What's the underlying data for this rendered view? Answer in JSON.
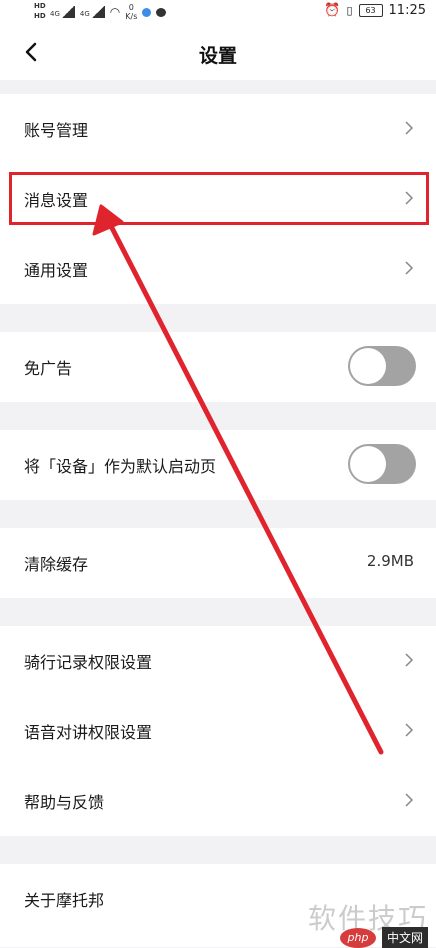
{
  "status_bar": {
    "hd1": "HD",
    "hd2": "HD",
    "sig1": "4G",
    "sig2": "4G",
    "speed_value": "0",
    "speed_unit": "K/s",
    "battery": "63",
    "time": "11:25"
  },
  "header": {
    "title": "设置"
  },
  "rows": {
    "account": {
      "label": "账号管理"
    },
    "message": {
      "label": "消息设置"
    },
    "general": {
      "label": "通用设置"
    },
    "ad_free": {
      "label": "免广告",
      "toggle": "off"
    },
    "device_home": {
      "label": "将「设备」作为默认启动页",
      "toggle": "off"
    },
    "clear_cache": {
      "label": "清除缓存",
      "value": "2.9MB"
    },
    "ride_record": {
      "label": "骑行记录权限设置"
    },
    "voice_talk": {
      "label": "语音对讲权限设置"
    },
    "help": {
      "label": "帮助与反馈"
    },
    "about": {
      "label": "关于摩托邦"
    }
  },
  "watermark": {
    "text": "软件技巧",
    "logo": "php",
    "site": "中文网"
  },
  "colors": {
    "highlight": "#e0242e",
    "toggle_off": "#a3a3a3",
    "background": "#f2f2f4"
  }
}
